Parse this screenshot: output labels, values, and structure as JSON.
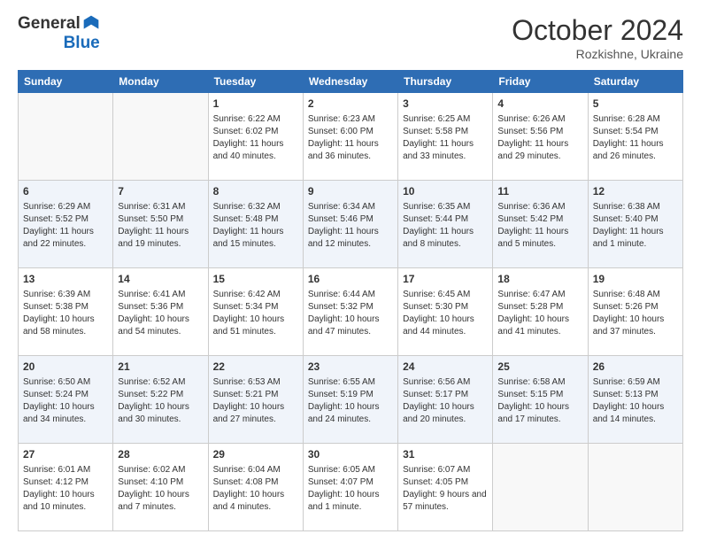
{
  "header": {
    "logo_line1": "General",
    "logo_line2": "Blue",
    "month": "October 2024",
    "location": "Rozkishne, Ukraine"
  },
  "days_of_week": [
    "Sunday",
    "Monday",
    "Tuesday",
    "Wednesday",
    "Thursday",
    "Friday",
    "Saturday"
  ],
  "weeks": [
    [
      {
        "day": "",
        "sunrise": "",
        "sunset": "",
        "daylight": ""
      },
      {
        "day": "",
        "sunrise": "",
        "sunset": "",
        "daylight": ""
      },
      {
        "day": "1",
        "sunrise": "Sunrise: 6:22 AM",
        "sunset": "Sunset: 6:02 PM",
        "daylight": "Daylight: 11 hours and 40 minutes."
      },
      {
        "day": "2",
        "sunrise": "Sunrise: 6:23 AM",
        "sunset": "Sunset: 6:00 PM",
        "daylight": "Daylight: 11 hours and 36 minutes."
      },
      {
        "day": "3",
        "sunrise": "Sunrise: 6:25 AM",
        "sunset": "Sunset: 5:58 PM",
        "daylight": "Daylight: 11 hours and 33 minutes."
      },
      {
        "day": "4",
        "sunrise": "Sunrise: 6:26 AM",
        "sunset": "Sunset: 5:56 PM",
        "daylight": "Daylight: 11 hours and 29 minutes."
      },
      {
        "day": "5",
        "sunrise": "Sunrise: 6:28 AM",
        "sunset": "Sunset: 5:54 PM",
        "daylight": "Daylight: 11 hours and 26 minutes."
      }
    ],
    [
      {
        "day": "6",
        "sunrise": "Sunrise: 6:29 AM",
        "sunset": "Sunset: 5:52 PM",
        "daylight": "Daylight: 11 hours and 22 minutes."
      },
      {
        "day": "7",
        "sunrise": "Sunrise: 6:31 AM",
        "sunset": "Sunset: 5:50 PM",
        "daylight": "Daylight: 11 hours and 19 minutes."
      },
      {
        "day": "8",
        "sunrise": "Sunrise: 6:32 AM",
        "sunset": "Sunset: 5:48 PM",
        "daylight": "Daylight: 11 hours and 15 minutes."
      },
      {
        "day": "9",
        "sunrise": "Sunrise: 6:34 AM",
        "sunset": "Sunset: 5:46 PM",
        "daylight": "Daylight: 11 hours and 12 minutes."
      },
      {
        "day": "10",
        "sunrise": "Sunrise: 6:35 AM",
        "sunset": "Sunset: 5:44 PM",
        "daylight": "Daylight: 11 hours and 8 minutes."
      },
      {
        "day": "11",
        "sunrise": "Sunrise: 6:36 AM",
        "sunset": "Sunset: 5:42 PM",
        "daylight": "Daylight: 11 hours and 5 minutes."
      },
      {
        "day": "12",
        "sunrise": "Sunrise: 6:38 AM",
        "sunset": "Sunset: 5:40 PM",
        "daylight": "Daylight: 11 hours and 1 minute."
      }
    ],
    [
      {
        "day": "13",
        "sunrise": "Sunrise: 6:39 AM",
        "sunset": "Sunset: 5:38 PM",
        "daylight": "Daylight: 10 hours and 58 minutes."
      },
      {
        "day": "14",
        "sunrise": "Sunrise: 6:41 AM",
        "sunset": "Sunset: 5:36 PM",
        "daylight": "Daylight: 10 hours and 54 minutes."
      },
      {
        "day": "15",
        "sunrise": "Sunrise: 6:42 AM",
        "sunset": "Sunset: 5:34 PM",
        "daylight": "Daylight: 10 hours and 51 minutes."
      },
      {
        "day": "16",
        "sunrise": "Sunrise: 6:44 AM",
        "sunset": "Sunset: 5:32 PM",
        "daylight": "Daylight: 10 hours and 47 minutes."
      },
      {
        "day": "17",
        "sunrise": "Sunrise: 6:45 AM",
        "sunset": "Sunset: 5:30 PM",
        "daylight": "Daylight: 10 hours and 44 minutes."
      },
      {
        "day": "18",
        "sunrise": "Sunrise: 6:47 AM",
        "sunset": "Sunset: 5:28 PM",
        "daylight": "Daylight: 10 hours and 41 minutes."
      },
      {
        "day": "19",
        "sunrise": "Sunrise: 6:48 AM",
        "sunset": "Sunset: 5:26 PM",
        "daylight": "Daylight: 10 hours and 37 minutes."
      }
    ],
    [
      {
        "day": "20",
        "sunrise": "Sunrise: 6:50 AM",
        "sunset": "Sunset: 5:24 PM",
        "daylight": "Daylight: 10 hours and 34 minutes."
      },
      {
        "day": "21",
        "sunrise": "Sunrise: 6:52 AM",
        "sunset": "Sunset: 5:22 PM",
        "daylight": "Daylight: 10 hours and 30 minutes."
      },
      {
        "day": "22",
        "sunrise": "Sunrise: 6:53 AM",
        "sunset": "Sunset: 5:21 PM",
        "daylight": "Daylight: 10 hours and 27 minutes."
      },
      {
        "day": "23",
        "sunrise": "Sunrise: 6:55 AM",
        "sunset": "Sunset: 5:19 PM",
        "daylight": "Daylight: 10 hours and 24 minutes."
      },
      {
        "day": "24",
        "sunrise": "Sunrise: 6:56 AM",
        "sunset": "Sunset: 5:17 PM",
        "daylight": "Daylight: 10 hours and 20 minutes."
      },
      {
        "day": "25",
        "sunrise": "Sunrise: 6:58 AM",
        "sunset": "Sunset: 5:15 PM",
        "daylight": "Daylight: 10 hours and 17 minutes."
      },
      {
        "day": "26",
        "sunrise": "Sunrise: 6:59 AM",
        "sunset": "Sunset: 5:13 PM",
        "daylight": "Daylight: 10 hours and 14 minutes."
      }
    ],
    [
      {
        "day": "27",
        "sunrise": "Sunrise: 6:01 AM",
        "sunset": "Sunset: 4:12 PM",
        "daylight": "Daylight: 10 hours and 10 minutes."
      },
      {
        "day": "28",
        "sunrise": "Sunrise: 6:02 AM",
        "sunset": "Sunset: 4:10 PM",
        "daylight": "Daylight: 10 hours and 7 minutes."
      },
      {
        "day": "29",
        "sunrise": "Sunrise: 6:04 AM",
        "sunset": "Sunset: 4:08 PM",
        "daylight": "Daylight: 10 hours and 4 minutes."
      },
      {
        "day": "30",
        "sunrise": "Sunrise: 6:05 AM",
        "sunset": "Sunset: 4:07 PM",
        "daylight": "Daylight: 10 hours and 1 minute."
      },
      {
        "day": "31",
        "sunrise": "Sunrise: 6:07 AM",
        "sunset": "Sunset: 4:05 PM",
        "daylight": "Daylight: 9 hours and 57 minutes."
      },
      {
        "day": "",
        "sunrise": "",
        "sunset": "",
        "daylight": ""
      },
      {
        "day": "",
        "sunrise": "",
        "sunset": "",
        "daylight": ""
      }
    ]
  ]
}
